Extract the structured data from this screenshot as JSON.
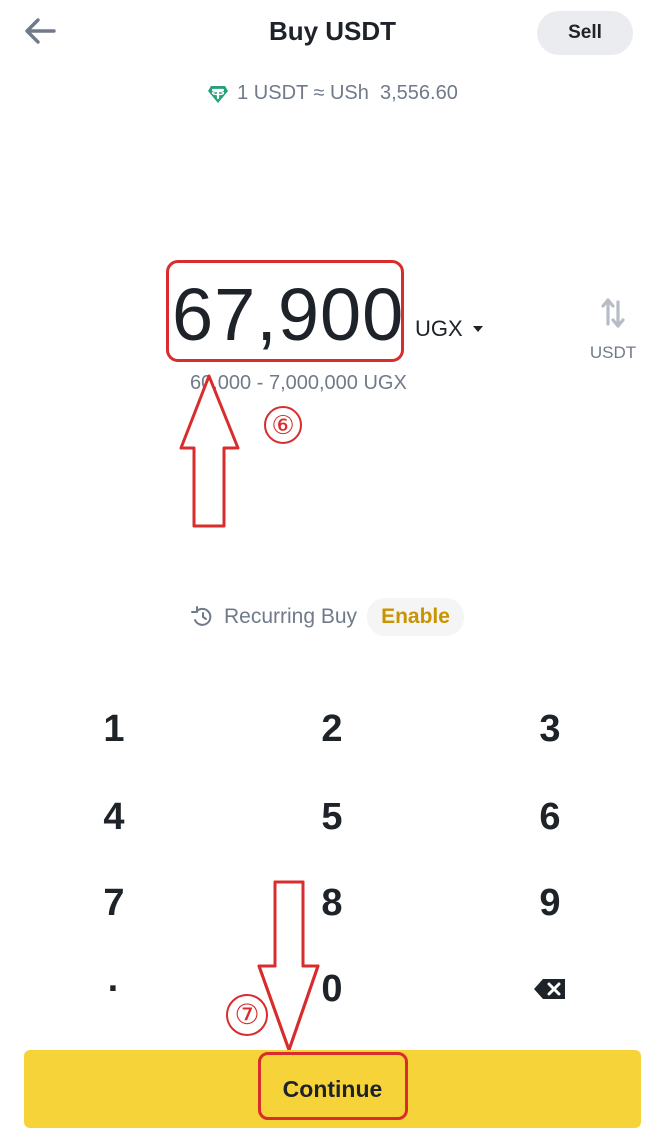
{
  "header": {
    "title": "Buy USDT",
    "sell_label": "Sell",
    "back_icon": "arrow-left-icon"
  },
  "rate": {
    "icon": "tether-icon",
    "text": "1 USDT ≈ USh  3,556.60"
  },
  "amount": {
    "value": "67,900",
    "currency": "UGX",
    "swap_label": "USDT",
    "range": "60,000 - 7,000,000 UGX"
  },
  "annotations": {
    "step6": "⑥",
    "step7": "⑦"
  },
  "recurring": {
    "label": "Recurring Buy",
    "enable_label": "Enable"
  },
  "keypad": {
    "keys": [
      "1",
      "2",
      "3",
      "4",
      "5",
      "6",
      "7",
      "8",
      "9",
      "·",
      "0",
      "⌫"
    ]
  },
  "continue_label": "Continue",
  "colors": {
    "accent": "#f7d33a",
    "annotation": "#d92c2c",
    "enable": "#c99400",
    "muted": "#707a8a",
    "tether": "#26a17b"
  }
}
